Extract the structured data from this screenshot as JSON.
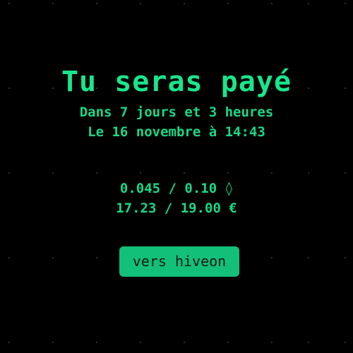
{
  "theme": {
    "background": "#000000",
    "accent": "#19e68c",
    "button_bg": "#12c07a",
    "button_text": "#0b1a12",
    "dot_color": "#3a3a3a"
  },
  "payment": {
    "title": "Tu seras payé",
    "countdown": "Dans 7 jours et 3 heures",
    "date": "Le 16 novembre à 14:43",
    "crypto_progress": "0.045 / 0.10 ◊",
    "fiat_progress": "17.23 / 19.00 €"
  },
  "actions": {
    "hiveon_label": "vers hiveon"
  }
}
